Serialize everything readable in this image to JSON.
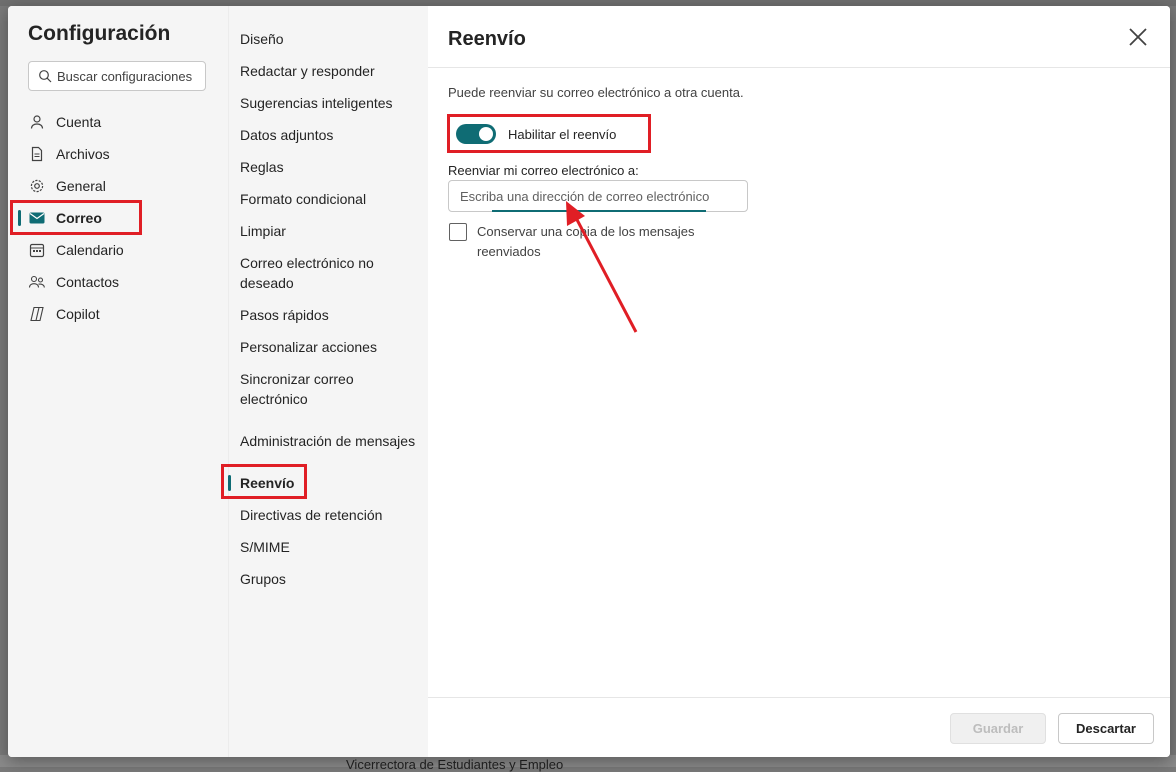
{
  "background": {
    "text": "Vicerrectora de Estudiantes y Empleo"
  },
  "sidebar": {
    "title": "Configuración",
    "search_placeholder": "Buscar configuraciones",
    "items": [
      {
        "label": "Cuenta",
        "icon": "person-icon"
      },
      {
        "label": "Archivos",
        "icon": "document-icon"
      },
      {
        "label": "General",
        "icon": "gear-icon"
      },
      {
        "label": "Correo",
        "icon": "mail-icon",
        "active": true
      },
      {
        "label": "Calendario",
        "icon": "calendar-icon"
      },
      {
        "label": "Contactos",
        "icon": "people-icon"
      },
      {
        "label": "Copilot",
        "icon": "copilot-icon"
      }
    ]
  },
  "subnav": {
    "items": [
      {
        "label": "Diseño"
      },
      {
        "label": "Redactar y responder"
      },
      {
        "label": "Sugerencias inteligentes"
      },
      {
        "label": "Datos adjuntos"
      },
      {
        "label": "Reglas"
      },
      {
        "label": "Formato condicional"
      },
      {
        "label": "Limpiar"
      },
      {
        "label": "Correo electrónico no deseado"
      },
      {
        "label": "Pasos rápidos"
      },
      {
        "label": "Personalizar acciones"
      },
      {
        "label": "Sincronizar correo electrónico"
      },
      {
        "label": "Administración de mensajes"
      },
      {
        "label": "Reenvío",
        "active": true
      },
      {
        "label": "Directivas de retención"
      },
      {
        "label": "S/MIME"
      },
      {
        "label": "Grupos"
      }
    ]
  },
  "panel": {
    "title": "Reenvío",
    "description": "Puede reenviar su correo electrónico a otra cuenta.",
    "toggle_label": "Habilitar el reenvío",
    "toggle_on": true,
    "field_label": "Reenviar mi correo electrónico a:",
    "email_value": "",
    "email_placeholder": "Escriba una dirección de correo electrónico",
    "keep_copy_label": "Conservar una copia de los mensajes reenviados",
    "keep_copy_checked": false
  },
  "footer": {
    "save_label": "Guardar",
    "discard_label": "Descartar"
  },
  "colors": {
    "accent": "#0f6c74",
    "highlight": "#e01e25"
  }
}
